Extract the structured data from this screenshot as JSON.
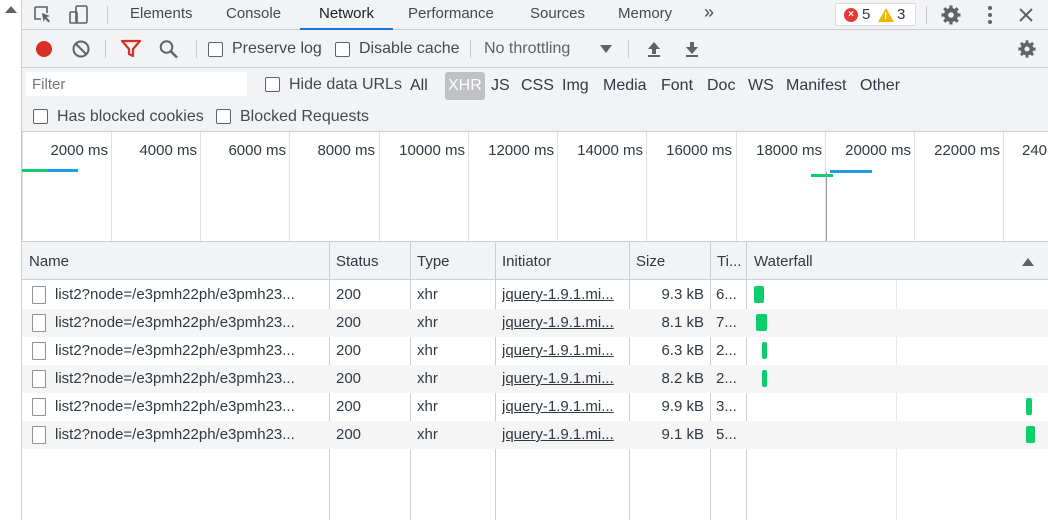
{
  "tabs": {
    "items": [
      "Elements",
      "Console",
      "Network",
      "Performance",
      "Sources",
      "Memory"
    ],
    "more": "»",
    "errors": "5",
    "warnings": "3"
  },
  "toolbar": {
    "preserve_log": "Preserve log",
    "disable_cache": "Disable cache",
    "throttling": "No throttling"
  },
  "filter": {
    "placeholder": "Filter",
    "hide_data_urls": "Hide data URLs",
    "types": [
      "All",
      "XHR",
      "JS",
      "CSS",
      "Img",
      "Media",
      "Font",
      "Doc",
      "WS",
      "Manifest",
      "Other"
    ],
    "selected_type": "XHR",
    "has_blocked_cookies": "Has blocked cookies",
    "blocked_requests": "Blocked Requests"
  },
  "overview": {
    "ticks": [
      "2000 ms",
      "4000 ms",
      "6000 ms",
      "8000 ms",
      "10000 ms",
      "12000 ms",
      "14000 ms",
      "16000 ms",
      "18000 ms",
      "20000 ms",
      "22000 ms",
      "240"
    ]
  },
  "table": {
    "columns": [
      "Name",
      "Status",
      "Type",
      "Initiator",
      "Size",
      "Ti...",
      "Waterfall"
    ],
    "rows": [
      {
        "name": "list2?node=/e3pmh22ph/e3pmh23...",
        "status": "200",
        "type": "xhr",
        "initiator": "jquery-1.9.1.mi...",
        "size": "9.3 kB",
        "time": "6..."
      },
      {
        "name": "list2?node=/e3pmh22ph/e3pmh23...",
        "status": "200",
        "type": "xhr",
        "initiator": "jquery-1.9.1.mi...",
        "size": "8.1 kB",
        "time": "7..."
      },
      {
        "name": "list2?node=/e3pmh22ph/e3pmh23...",
        "status": "200",
        "type": "xhr",
        "initiator": "jquery-1.9.1.mi...",
        "size": "6.3 kB",
        "time": "2..."
      },
      {
        "name": "list2?node=/e3pmh22ph/e3pmh23...",
        "status": "200",
        "type": "xhr",
        "initiator": "jquery-1.9.1.mi...",
        "size": "8.2 kB",
        "time": "2..."
      },
      {
        "name": "list2?node=/e3pmh22ph/e3pmh23...",
        "status": "200",
        "type": "xhr",
        "initiator": "jquery-1.9.1.mi...",
        "size": "9.9 kB",
        "time": "3..."
      },
      {
        "name": "list2?node=/e3pmh22ph/e3pmh23...",
        "status": "200",
        "type": "xhr",
        "initiator": "jquery-1.9.1.mi...",
        "size": "9.1 kB",
        "time": "5..."
      }
    ]
  },
  "colors": {
    "accent": "#1a73e8",
    "record": "#d93025",
    "waterfall_bar": "#0cce6b",
    "overview_green": "#0cce6b",
    "overview_blue": "#1e9ee6"
  }
}
